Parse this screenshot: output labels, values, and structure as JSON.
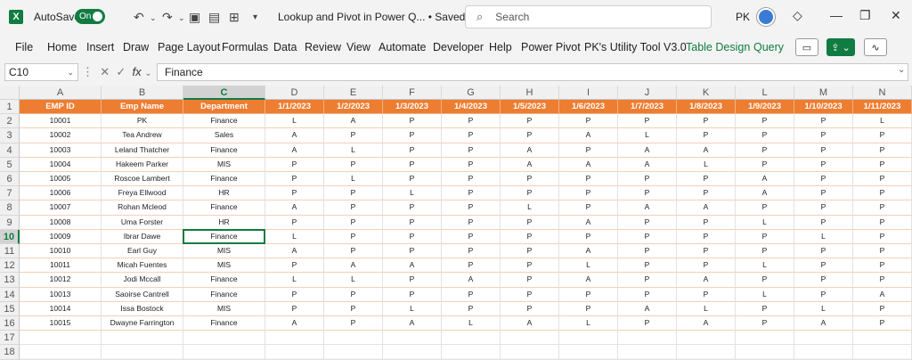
{
  "titlebar": {
    "app_icon": "X",
    "autosave_label": "AutoSave",
    "toggle_label": "On",
    "doc_title": "Lookup and Pivot in Power Q...  •  Saved",
    "search_placeholder": "Search",
    "user_initials": "PK"
  },
  "menu": [
    "File",
    "Home",
    "Insert",
    "Draw",
    "Page Layout",
    "Formulas",
    "Data",
    "Review",
    "View",
    "Automate",
    "Developer",
    "Help",
    "Power Pivot",
    "PK's Utility Tool V3.0"
  ],
  "context_tabs": [
    "Table Design",
    "Query"
  ],
  "formula": {
    "namebox": "C10",
    "fx": "fx",
    "content": "Finance"
  },
  "columns": [
    "A",
    "B",
    "C",
    "D",
    "E",
    "F",
    "G",
    "H",
    "I",
    "J",
    "K",
    "L",
    "M",
    "N"
  ],
  "selected_column": "C",
  "selected_row": 10,
  "header_row": [
    "EMP ID",
    "Emp Name",
    "Department",
    "1/1/2023",
    "1/2/2023",
    "1/3/2023",
    "1/4/2023",
    "1/5/2023",
    "1/6/2023",
    "1/7/2023",
    "1/8/2023",
    "1/9/2023",
    "1/10/2023",
    "1/11/2023"
  ],
  "rows": [
    [
      "10001",
      "PK",
      "Finance",
      "L",
      "A",
      "P",
      "P",
      "P",
      "P",
      "P",
      "P",
      "P",
      "P",
      "L"
    ],
    [
      "10002",
      "Tea Andrew",
      "Sales",
      "A",
      "P",
      "P",
      "P",
      "P",
      "A",
      "L",
      "P",
      "P",
      "P",
      "P"
    ],
    [
      "10003",
      "Leland Thatcher",
      "Finance",
      "A",
      "L",
      "P",
      "P",
      "A",
      "P",
      "A",
      "A",
      "P",
      "P",
      "P"
    ],
    [
      "10004",
      "Hakeem Parker",
      "MIS",
      "P",
      "P",
      "P",
      "P",
      "A",
      "A",
      "A",
      "L",
      "P",
      "P",
      "P"
    ],
    [
      "10005",
      "Roscoe Lambert",
      "Finance",
      "P",
      "L",
      "P",
      "P",
      "P",
      "P",
      "P",
      "P",
      "A",
      "P",
      "P"
    ],
    [
      "10006",
      "Freya Ellwood",
      "HR",
      "P",
      "P",
      "L",
      "P",
      "P",
      "P",
      "P",
      "P",
      "A",
      "P",
      "P"
    ],
    [
      "10007",
      "Rohan Mcleod",
      "Finance",
      "A",
      "P",
      "P",
      "P",
      "L",
      "P",
      "A",
      "A",
      "P",
      "P",
      "P"
    ],
    [
      "10008",
      "Uma Forster",
      "HR",
      "P",
      "P",
      "P",
      "P",
      "P",
      "A",
      "P",
      "P",
      "L",
      "P",
      "P"
    ],
    [
      "10009",
      "Ibrar Dawe",
      "Finance",
      "L",
      "P",
      "P",
      "P",
      "P",
      "P",
      "P",
      "P",
      "P",
      "L",
      "P"
    ],
    [
      "10010",
      "Earl Guy",
      "MIS",
      "A",
      "P",
      "P",
      "P",
      "P",
      "A",
      "P",
      "P",
      "P",
      "P",
      "P"
    ],
    [
      "10011",
      "Micah Fuentes",
      "MIS",
      "P",
      "A",
      "A",
      "P",
      "P",
      "L",
      "P",
      "P",
      "L",
      "P",
      "P"
    ],
    [
      "10012",
      "Jodi Mccall",
      "Finance",
      "L",
      "L",
      "P",
      "A",
      "P",
      "A",
      "P",
      "A",
      "P",
      "P",
      "P"
    ],
    [
      "10013",
      "Saoirse Cantrell",
      "Finance",
      "P",
      "P",
      "P",
      "P",
      "P",
      "P",
      "P",
      "P",
      "L",
      "P",
      "A"
    ],
    [
      "10014",
      "Issa Bostock",
      "MIS",
      "P",
      "P",
      "L",
      "P",
      "P",
      "P",
      "A",
      "L",
      "P",
      "L",
      "P"
    ],
    [
      "10015",
      "Dwayne Farrington",
      "Finance",
      "A",
      "P",
      "A",
      "L",
      "A",
      "L",
      "P",
      "A",
      "P",
      "A",
      "P"
    ]
  ],
  "empty_rows": [
    "17",
    "18"
  ],
  "colors": {
    "excel_green": "#107c41",
    "header_orange": "#ed7d31"
  }
}
